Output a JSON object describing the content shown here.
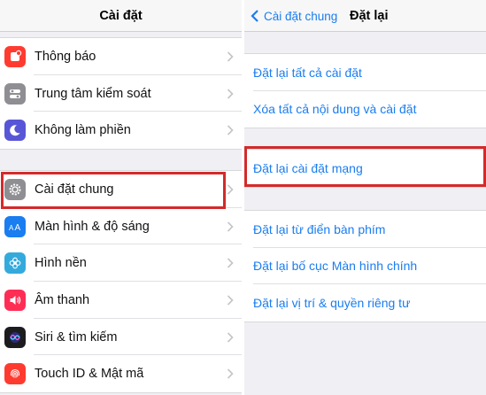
{
  "left": {
    "title": "Cài đặt",
    "group1": [
      {
        "label": "Thông báo",
        "icon": "notifications-icon",
        "color": "#ff3b30"
      },
      {
        "label": "Trung tâm kiểm soát",
        "icon": "control-center-icon",
        "color": "#8e8e93"
      },
      {
        "label": "Không làm phiền",
        "icon": "do-not-disturb-icon",
        "color": "#5856d6"
      }
    ],
    "group2": [
      {
        "label": "Cài đặt chung",
        "icon": "gear-icon",
        "color": "#8e8e93"
      },
      {
        "label": "Màn hình & độ sáng",
        "icon": "display-brightness-icon",
        "color": "#1a7df0"
      },
      {
        "label": "Hình nền",
        "icon": "wallpaper-icon",
        "color": "#34aadc"
      },
      {
        "label": "Âm thanh",
        "icon": "sounds-icon",
        "color": "#ff2d55"
      },
      {
        "label": "Siri & tìm kiếm",
        "icon": "siri-icon",
        "color": "#1c1c1e"
      },
      {
        "label": "Touch ID & Mật mã",
        "icon": "touch-id-icon",
        "color": "#ff3b30"
      }
    ]
  },
  "right": {
    "back_label": "Cài đặt chung",
    "title": "Đặt lại",
    "group1": [
      "Đặt lại tất cả cài đặt",
      "Xóa tất cả nội dung và cài đặt"
    ],
    "group2": [
      "Đặt lại cài đặt mạng"
    ],
    "group3": [
      "Đặt lại từ điển bàn phím",
      "Đặt lại bố cục Màn hình chính",
      "Đặt lại vị trí & quyền riêng tư"
    ]
  },
  "colors": {
    "accent": "#1a7df0",
    "highlight": "#d42a2a",
    "background": "#efeff4"
  }
}
